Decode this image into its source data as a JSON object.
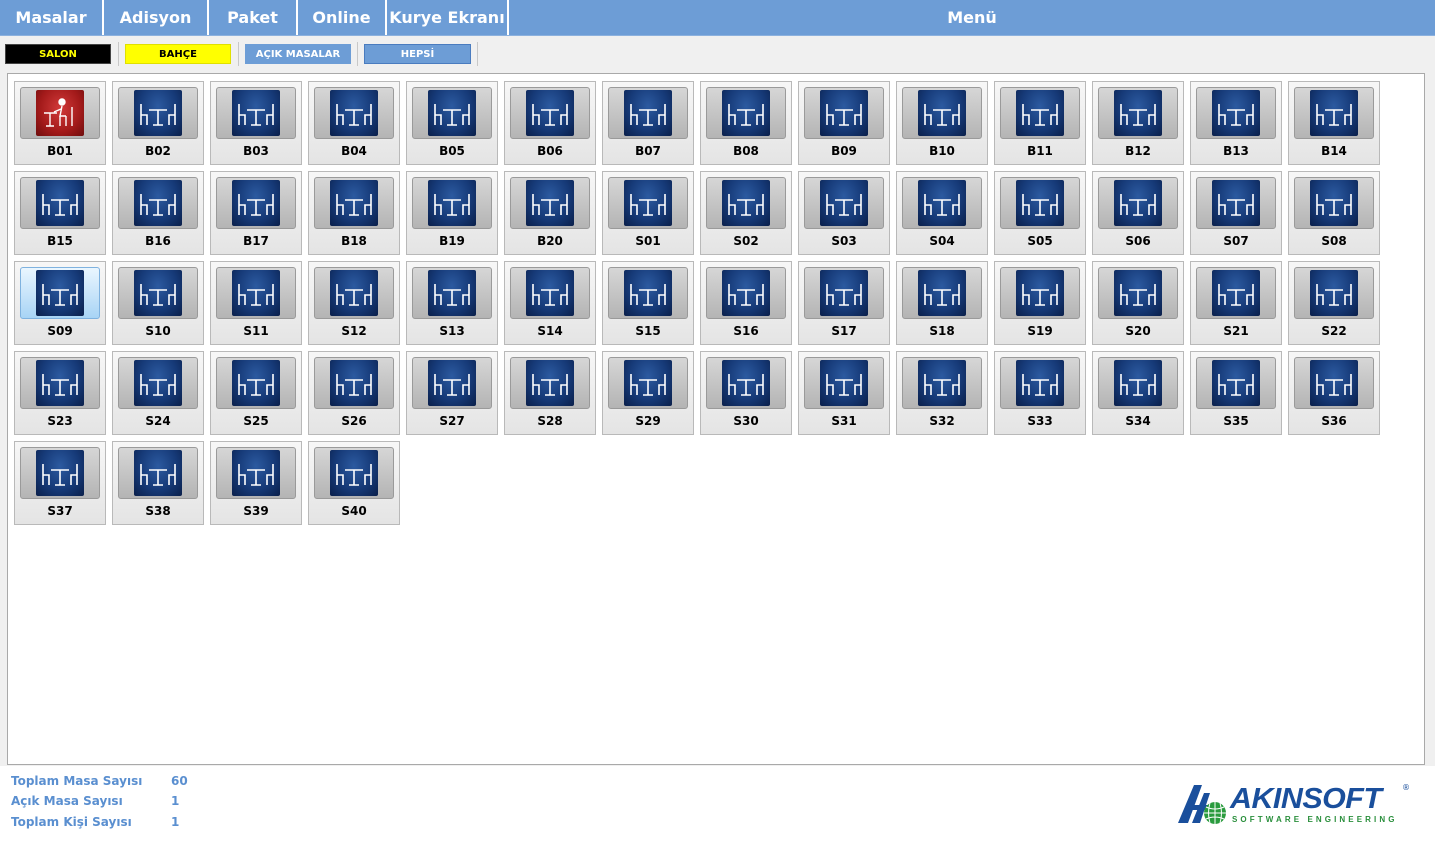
{
  "nav": {
    "masalar": "Masalar",
    "adisyon": "Adisyon",
    "paket": "Paket",
    "online": "Online",
    "kurye": "Kurye Ekranı",
    "menu": "Menü"
  },
  "filters": {
    "salon": "SALON",
    "bahce": "BAHÇE",
    "acik_masalar": "AÇIK MASALAR",
    "hepsi": "HEPSİ"
  },
  "colors": {
    "salon_bg": "#000000",
    "salon_fg": "#ffff00",
    "bahce_bg": "#ffff00",
    "bahce_fg": "#000000",
    "acik_bg": "#6d9dd6",
    "hepsi_bg": "#6d9dd6",
    "accent": "#6d9dd6",
    "occupied": "#b01e1e"
  },
  "tables": [
    {
      "label": "B01",
      "status": "occupied",
      "icon": "person-at-table-icon"
    },
    {
      "label": "B02",
      "status": "empty",
      "icon": "dining-table-icon"
    },
    {
      "label": "B03",
      "status": "empty",
      "icon": "dining-table-icon"
    },
    {
      "label": "B04",
      "status": "empty",
      "icon": "dining-table-icon"
    },
    {
      "label": "B05",
      "status": "empty",
      "icon": "dining-table-icon"
    },
    {
      "label": "B06",
      "status": "empty",
      "icon": "dining-table-icon"
    },
    {
      "label": "B07",
      "status": "empty",
      "icon": "dining-table-icon"
    },
    {
      "label": "B08",
      "status": "empty",
      "icon": "dining-table-icon"
    },
    {
      "label": "B09",
      "status": "empty",
      "icon": "dining-table-icon"
    },
    {
      "label": "B10",
      "status": "empty",
      "icon": "dining-table-icon"
    },
    {
      "label": "B11",
      "status": "empty",
      "icon": "dining-table-icon"
    },
    {
      "label": "B12",
      "status": "empty",
      "icon": "dining-table-icon"
    },
    {
      "label": "B13",
      "status": "empty",
      "icon": "dining-table-icon"
    },
    {
      "label": "B14",
      "status": "empty",
      "icon": "dining-table-icon"
    },
    {
      "label": "B15",
      "status": "empty",
      "icon": "dining-table-icon"
    },
    {
      "label": "B16",
      "status": "empty",
      "icon": "dining-table-icon"
    },
    {
      "label": "B17",
      "status": "empty",
      "icon": "dining-table-icon"
    },
    {
      "label": "B18",
      "status": "empty",
      "icon": "dining-table-icon"
    },
    {
      "label": "B19",
      "status": "empty",
      "icon": "dining-table-icon"
    },
    {
      "label": "B20",
      "status": "empty",
      "icon": "dining-table-icon"
    },
    {
      "label": "S01",
      "status": "empty",
      "icon": "dining-table-icon"
    },
    {
      "label": "S02",
      "status": "empty",
      "icon": "dining-table-icon"
    },
    {
      "label": "S03",
      "status": "empty",
      "icon": "dining-table-icon"
    },
    {
      "label": "S04",
      "status": "empty",
      "icon": "dining-table-icon"
    },
    {
      "label": "S05",
      "status": "empty",
      "icon": "dining-table-icon"
    },
    {
      "label": "S06",
      "status": "empty",
      "icon": "dining-table-icon"
    },
    {
      "label": "S07",
      "status": "empty",
      "icon": "dining-table-icon"
    },
    {
      "label": "S08",
      "status": "empty",
      "icon": "dining-table-icon"
    },
    {
      "label": "S09",
      "status": "selected",
      "icon": "dining-table-icon"
    },
    {
      "label": "S10",
      "status": "empty",
      "icon": "dining-table-icon"
    },
    {
      "label": "S11",
      "status": "empty",
      "icon": "dining-table-icon"
    },
    {
      "label": "S12",
      "status": "empty",
      "icon": "dining-table-icon"
    },
    {
      "label": "S13",
      "status": "empty",
      "icon": "dining-table-icon"
    },
    {
      "label": "S14",
      "status": "empty",
      "icon": "dining-table-icon"
    },
    {
      "label": "S15",
      "status": "empty",
      "icon": "dining-table-icon"
    },
    {
      "label": "S16",
      "status": "empty",
      "icon": "dining-table-icon"
    },
    {
      "label": "S17",
      "status": "empty",
      "icon": "dining-table-icon"
    },
    {
      "label": "S18",
      "status": "empty",
      "icon": "dining-table-icon"
    },
    {
      "label": "S19",
      "status": "empty",
      "icon": "dining-table-icon"
    },
    {
      "label": "S20",
      "status": "empty",
      "icon": "dining-table-icon"
    },
    {
      "label": "S21",
      "status": "empty",
      "icon": "dining-table-icon"
    },
    {
      "label": "S22",
      "status": "empty",
      "icon": "dining-table-icon"
    },
    {
      "label": "S23",
      "status": "empty",
      "icon": "dining-table-icon"
    },
    {
      "label": "S24",
      "status": "empty",
      "icon": "dining-table-icon"
    },
    {
      "label": "S25",
      "status": "empty",
      "icon": "dining-table-icon"
    },
    {
      "label": "S26",
      "status": "empty",
      "icon": "dining-table-icon"
    },
    {
      "label": "S27",
      "status": "empty",
      "icon": "dining-table-icon"
    },
    {
      "label": "S28",
      "status": "empty",
      "icon": "dining-table-icon"
    },
    {
      "label": "S29",
      "status": "empty",
      "icon": "dining-table-icon"
    },
    {
      "label": "S30",
      "status": "empty",
      "icon": "dining-table-icon"
    },
    {
      "label": "S31",
      "status": "empty",
      "icon": "dining-table-icon"
    },
    {
      "label": "S32",
      "status": "empty",
      "icon": "dining-table-icon"
    },
    {
      "label": "S33",
      "status": "empty",
      "icon": "dining-table-icon"
    },
    {
      "label": "S34",
      "status": "empty",
      "icon": "dining-table-icon"
    },
    {
      "label": "S35",
      "status": "empty",
      "icon": "dining-table-icon"
    },
    {
      "label": "S36",
      "status": "empty",
      "icon": "dining-table-icon"
    },
    {
      "label": "S37",
      "status": "empty",
      "icon": "dining-table-icon"
    },
    {
      "label": "S38",
      "status": "empty",
      "icon": "dining-table-icon"
    },
    {
      "label": "S39",
      "status": "empty",
      "icon": "dining-table-icon"
    },
    {
      "label": "S40",
      "status": "empty",
      "icon": "dining-table-icon"
    }
  ],
  "stats": {
    "total_tables_label": "Toplam Masa Sayısı",
    "total_tables_value": "60",
    "open_tables_label": "Açık Masa Sayısı",
    "open_tables_value": "1",
    "total_people_label": "Toplam Kişi Sayısı",
    "total_people_value": "1"
  },
  "brand": {
    "name": "AKINSOFT",
    "tagline": "SOFTWARE ENGINEERING",
    "reg": "®"
  }
}
